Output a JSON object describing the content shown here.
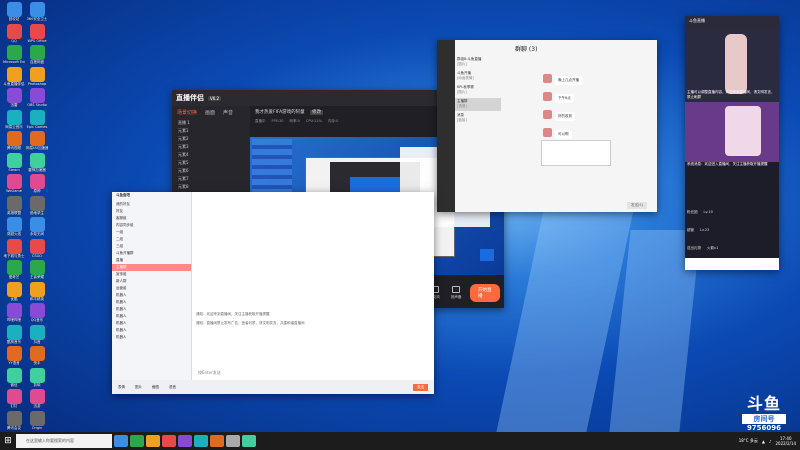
{
  "desktop": {
    "icons": [
      "回收站",
      "QQ",
      "Microsoft Edge",
      "斗鱼直播伴侣",
      "迅雷",
      "网易云音乐",
      "腾讯视频",
      "Steam",
      "WeGame",
      "英雄联盟",
      "穿越火线",
      "地下城与勇士",
      "爱奇艺",
      "优酷",
      "哔哩哔哩",
      "酷狗音乐",
      "YY语音",
      "微信",
      "钉钉",
      "腾讯会议",
      "360安全卫士",
      "WPS Office",
      "百度网盘",
      "Photoshop",
      "OBS Studio",
      "Epic Games",
      "网易UU加速器",
      "雷神加速器",
      "原神",
      "绝地求生",
      "永劫无间",
      "CSGO",
      "王者荣耀",
      "和平精英",
      "QQ音乐",
      "抖音",
      "快手",
      "剪映",
      "迅游",
      "Origin"
    ]
  },
  "zhibo": {
    "logo": "直播伴侣",
    "version": "V6.2",
    "tabs": [
      "场景切换",
      "画面",
      "声音"
    ],
    "scenes": [
      "直播 1",
      "元素1",
      "元素2",
      "元素3",
      "元素4",
      "元素5",
      "元素6",
      "元素7",
      "元素8"
    ],
    "scene_label": "场景1",
    "tools": [
      "图片素材",
      "摄像头",
      "文字素材",
      "窗口截取",
      "游戏",
      "屏幕截取",
      "画中画",
      "音频",
      "更多素材",
      "多媒体",
      "弹幕助手"
    ],
    "title": "我才热爱FIFA游戏的阿童",
    "room_tag": "修改",
    "bar": [
      "直播中",
      "FPS:30",
      "码率:0",
      "CPU:11%",
      "内存:0"
    ],
    "footer": [
      "画面特效",
      "美颜",
      "滤镜",
      "虚拟形象",
      "弹幕",
      "连麦",
      "录屏",
      "音乐",
      "麦克风",
      "扬声器"
    ],
    "start_label": "开始直播"
  },
  "qun": {
    "title": "群聊 (3)",
    "items": [
      {
        "name": "群组8:斗鱼直播",
        "sub": "[图片]"
      },
      {
        "name": "斗鱼开播",
        "sub": "[动画表情]"
      },
      {
        "name": "KPL秋季赛",
        "sub": "[图片]"
      },
      {
        "name": "主播群",
        "sub": "[语音]"
      },
      {
        "name": "消息",
        "sub": "[链接]"
      }
    ],
    "msgs": [
      "晚上几点开播",
      "下午6点",
      "好的收到",
      "可以啊"
    ],
    "send": "发送(S)"
  },
  "phone": {
    "header": "斗鱼直播",
    "banner_text": "主播可以调整直播内容，欢迎来到直播间，请文明发言，禁止刷屏",
    "notice": "系统消息：欢迎进入直播间，关注主播获取开播提醒",
    "rows": [
      {
        "name": "粉丝团",
        "value": "Lv.10"
      },
      {
        "name": "超管",
        "value": "Lv.23"
      },
      {
        "name": "送出礼物",
        "value": "火箭x1"
      }
    ]
  },
  "chatapp": {
    "title": "斗鱼鱼吧",
    "groups": [
      "我的好友",
      "好友",
      "客服组",
      "内容同步组",
      "一组",
      "二组",
      "三组",
      "斗鱼开播群",
      "直播",
      "主播群",
      "宣传组",
      "新人群",
      "运营组",
      "机器人",
      "机器人",
      "机器人",
      "机器人",
      "机器人",
      "机器人",
      "机器人"
    ],
    "notice1": "通知：欢迎来到直播间，关注主播获取开播提醒",
    "notice2": "通知：直播间禁止发布广告，违者封禁，请文明发言，共建和谐直播间",
    "input_placeholder": "按Enter发送",
    "footer": [
      "表情",
      "图片",
      "截图",
      "语音",
      "发送"
    ]
  },
  "watermark": {
    "brand": "斗鱼",
    "label": "房间号",
    "room": "9756096"
  },
  "taskbar": {
    "search_placeholder": "在这里输入你要搜索的内容",
    "time": "17:40",
    "date": "2022/2/14",
    "weather": "18°C 多云"
  }
}
